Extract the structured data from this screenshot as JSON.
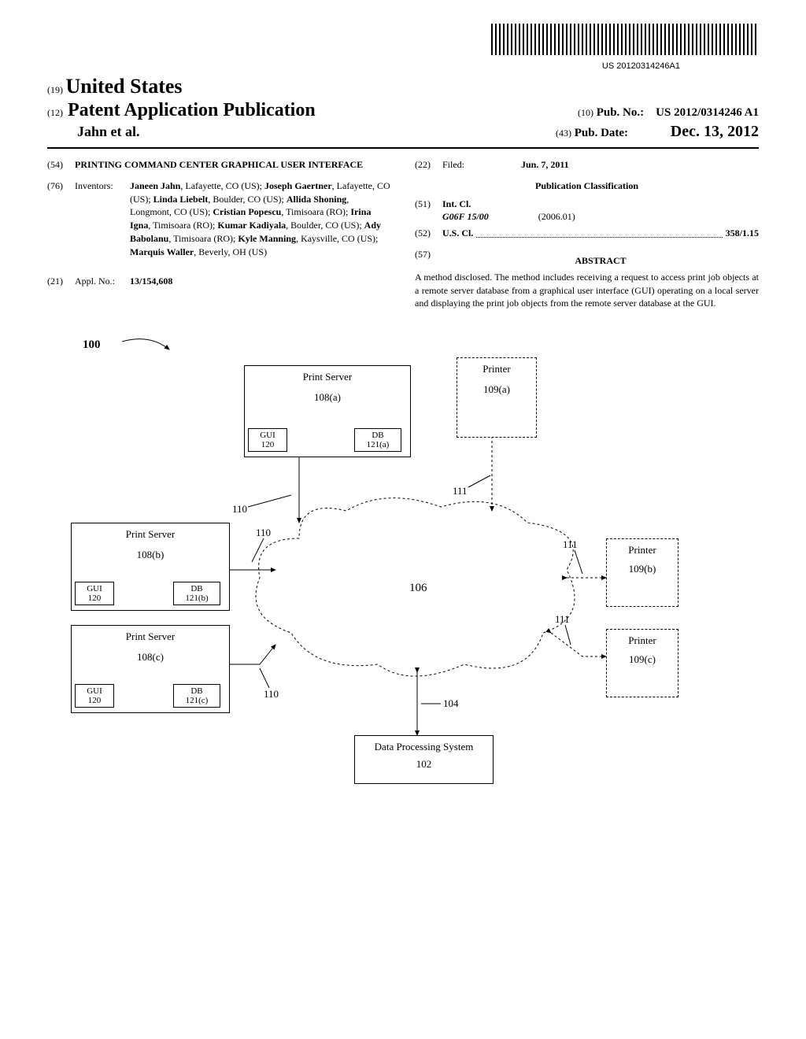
{
  "barcode_number": "US 20120314246A1",
  "header": {
    "code19": "(19)",
    "country": "United States",
    "code12": "(12)",
    "pub_type": "Patent Application Publication",
    "authors_header": "Jahn et al.",
    "code10": "(10)",
    "pubno_label": "Pub. No.:",
    "pubno": "US 2012/0314246 A1",
    "code43": "(43)",
    "pubdate_label": "Pub. Date:",
    "pubdate": "Dec. 13, 2012"
  },
  "left_col": {
    "code54": "(54)",
    "title": "PRINTING COMMAND CENTER GRAPHICAL USER INTERFACE",
    "code76": "(76)",
    "inventors_label": "Inventors:",
    "inventors_text": "Janeen Jahn, Lafayette, CO (US); Joseph Gaertner, Lafayette, CO (US); Linda Liebelt, Boulder, CO (US); Allida Shoning, Longmont, CO (US); Cristian Popescu, Timisoara (RO); Irina Igna, Timisoara (RO); Kumar Kadiyala, Boulder, CO (US); Ady Babolanu, Timisoara (RO); Kyle Manning, Kaysville, CO (US); Marquis Waller, Beverly, OH (US)",
    "code21": "(21)",
    "applno_label": "Appl. No.:",
    "applno": "13/154,608"
  },
  "right_col": {
    "code22": "(22)",
    "filed_label": "Filed:",
    "filed_date": "Jun. 7, 2011",
    "pub_class_heading": "Publication Classification",
    "code51": "(51)",
    "intcl_label": "Int. Cl.",
    "intcl_code": "G06F 15/00",
    "intcl_year": "(2006.01)",
    "code52": "(52)",
    "uscl_label": "U.S. Cl.",
    "uscl_value": "358/1.15",
    "code57": "(57)",
    "abstract_heading": "ABSTRACT",
    "abstract_text": "A method disclosed. The method includes receiving a request to access print job objects at a remote server database from a graphical user interface (GUI) operating on a local server and displaying the print job objects from the remote server database at the GUI."
  },
  "figure": {
    "ref100": "100",
    "print_server": "Print Server",
    "ps_a": "108(a)",
    "ps_b": "108(b)",
    "ps_c": "108(c)",
    "printer": "Printer",
    "pr_a": "109(a)",
    "pr_b": "109(b)",
    "pr_c": "109(c)",
    "gui": "GUI",
    "gui_num": "120",
    "db": "DB",
    "db_a": "121(a)",
    "db_b": "121(b)",
    "db_c": "121(c)",
    "cloud_num": "106",
    "n110": "110",
    "n111": "111",
    "n104": "104",
    "dps_label": "Data Processing System",
    "dps_num": "102"
  }
}
